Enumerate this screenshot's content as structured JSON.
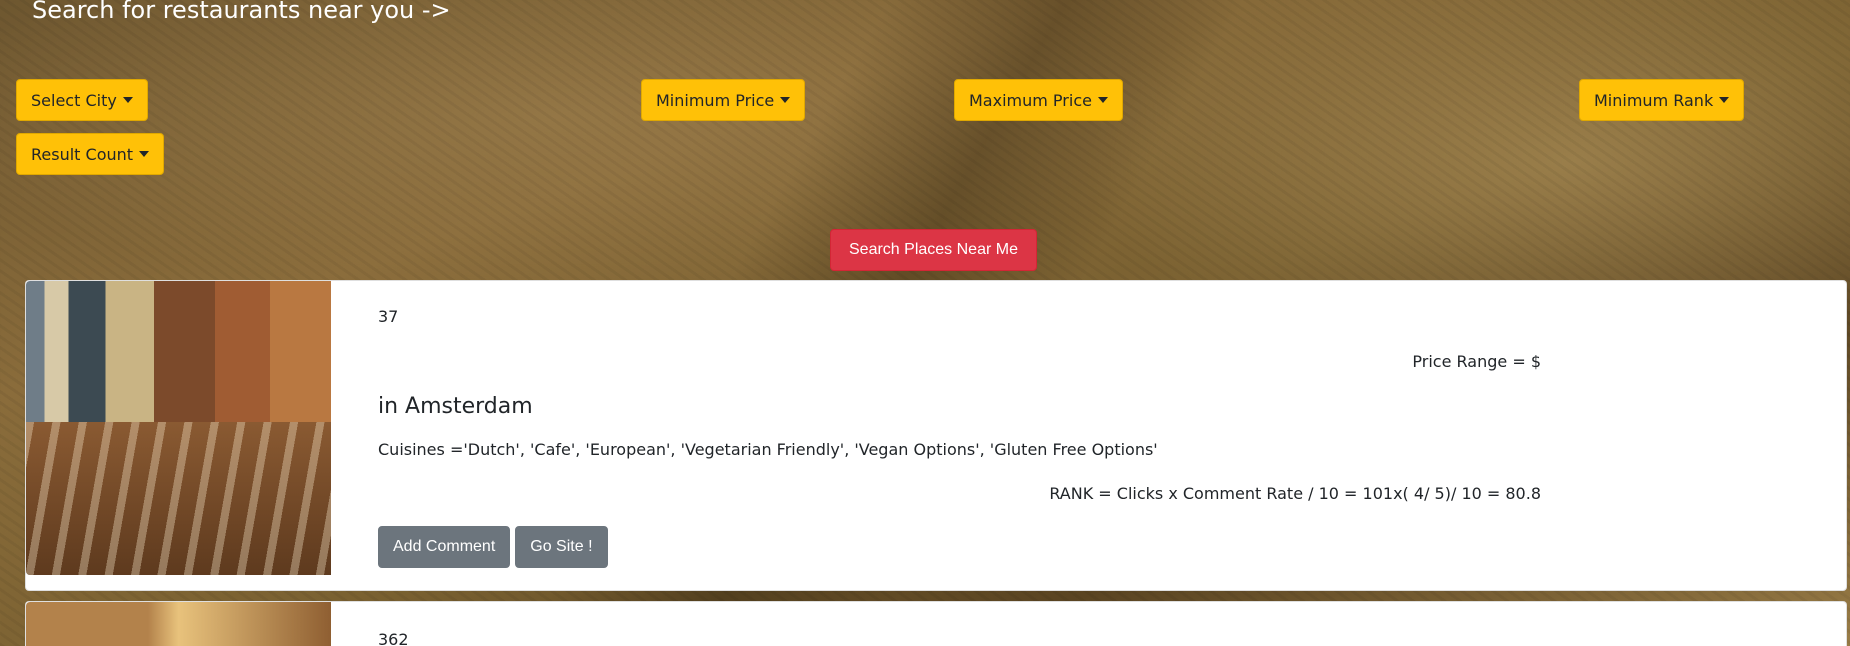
{
  "heading": "Search for restaurants near you ->",
  "filters": {
    "city": "Select City",
    "min_price": "Minimum Price",
    "max_price": "Maximum Price",
    "min_rank": "Minimum Rank",
    "result_count": "Result Count"
  },
  "search_button": "Search Places Near Me",
  "results": [
    {
      "number": "37",
      "price_range": "Price Range = $",
      "city": "in Amsterdam",
      "cuisines": "Cuisines ='Dutch', 'Cafe', 'European', 'Vegetarian Friendly', 'Vegan Options', 'Gluten Free Options'",
      "rank": "RANK = Clicks x Comment Rate / 10 = 101x( 4/ 5)/ 10 = 80.8",
      "add_comment": "Add Comment",
      "go_site": "Go Site !"
    },
    {
      "number": "362"
    }
  ],
  "colors": {
    "filter_button": "#ffc107",
    "search_button": "#dc3545",
    "secondary_button": "#6c757d"
  }
}
